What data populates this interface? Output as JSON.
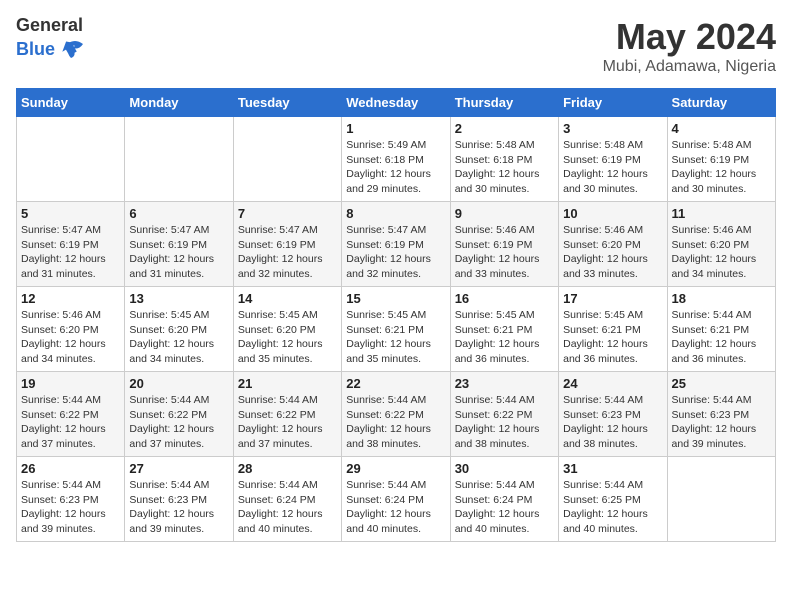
{
  "header": {
    "logo_general": "General",
    "logo_blue": "Blue",
    "title": "May 2024",
    "subtitle": "Mubi, Adamawa, Nigeria"
  },
  "columns": [
    "Sunday",
    "Monday",
    "Tuesday",
    "Wednesday",
    "Thursday",
    "Friday",
    "Saturday"
  ],
  "weeks": [
    [
      {
        "day": "",
        "info": ""
      },
      {
        "day": "",
        "info": ""
      },
      {
        "day": "",
        "info": ""
      },
      {
        "day": "1",
        "info": "Sunrise: 5:49 AM\nSunset: 6:18 PM\nDaylight: 12 hours\nand 29 minutes."
      },
      {
        "day": "2",
        "info": "Sunrise: 5:48 AM\nSunset: 6:18 PM\nDaylight: 12 hours\nand 30 minutes."
      },
      {
        "day": "3",
        "info": "Sunrise: 5:48 AM\nSunset: 6:19 PM\nDaylight: 12 hours\nand 30 minutes."
      },
      {
        "day": "4",
        "info": "Sunrise: 5:48 AM\nSunset: 6:19 PM\nDaylight: 12 hours\nand 30 minutes."
      }
    ],
    [
      {
        "day": "5",
        "info": "Sunrise: 5:47 AM\nSunset: 6:19 PM\nDaylight: 12 hours\nand 31 minutes."
      },
      {
        "day": "6",
        "info": "Sunrise: 5:47 AM\nSunset: 6:19 PM\nDaylight: 12 hours\nand 31 minutes."
      },
      {
        "day": "7",
        "info": "Sunrise: 5:47 AM\nSunset: 6:19 PM\nDaylight: 12 hours\nand 32 minutes."
      },
      {
        "day": "8",
        "info": "Sunrise: 5:47 AM\nSunset: 6:19 PM\nDaylight: 12 hours\nand 32 minutes."
      },
      {
        "day": "9",
        "info": "Sunrise: 5:46 AM\nSunset: 6:19 PM\nDaylight: 12 hours\nand 33 minutes."
      },
      {
        "day": "10",
        "info": "Sunrise: 5:46 AM\nSunset: 6:20 PM\nDaylight: 12 hours\nand 33 minutes."
      },
      {
        "day": "11",
        "info": "Sunrise: 5:46 AM\nSunset: 6:20 PM\nDaylight: 12 hours\nand 34 minutes."
      }
    ],
    [
      {
        "day": "12",
        "info": "Sunrise: 5:46 AM\nSunset: 6:20 PM\nDaylight: 12 hours\nand 34 minutes."
      },
      {
        "day": "13",
        "info": "Sunrise: 5:45 AM\nSunset: 6:20 PM\nDaylight: 12 hours\nand 34 minutes."
      },
      {
        "day": "14",
        "info": "Sunrise: 5:45 AM\nSunset: 6:20 PM\nDaylight: 12 hours\nand 35 minutes."
      },
      {
        "day": "15",
        "info": "Sunrise: 5:45 AM\nSunset: 6:21 PM\nDaylight: 12 hours\nand 35 minutes."
      },
      {
        "day": "16",
        "info": "Sunrise: 5:45 AM\nSunset: 6:21 PM\nDaylight: 12 hours\nand 36 minutes."
      },
      {
        "day": "17",
        "info": "Sunrise: 5:45 AM\nSunset: 6:21 PM\nDaylight: 12 hours\nand 36 minutes."
      },
      {
        "day": "18",
        "info": "Sunrise: 5:44 AM\nSunset: 6:21 PM\nDaylight: 12 hours\nand 36 minutes."
      }
    ],
    [
      {
        "day": "19",
        "info": "Sunrise: 5:44 AM\nSunset: 6:22 PM\nDaylight: 12 hours\nand 37 minutes."
      },
      {
        "day": "20",
        "info": "Sunrise: 5:44 AM\nSunset: 6:22 PM\nDaylight: 12 hours\nand 37 minutes."
      },
      {
        "day": "21",
        "info": "Sunrise: 5:44 AM\nSunset: 6:22 PM\nDaylight: 12 hours\nand 37 minutes."
      },
      {
        "day": "22",
        "info": "Sunrise: 5:44 AM\nSunset: 6:22 PM\nDaylight: 12 hours\nand 38 minutes."
      },
      {
        "day": "23",
        "info": "Sunrise: 5:44 AM\nSunset: 6:22 PM\nDaylight: 12 hours\nand 38 minutes."
      },
      {
        "day": "24",
        "info": "Sunrise: 5:44 AM\nSunset: 6:23 PM\nDaylight: 12 hours\nand 38 minutes."
      },
      {
        "day": "25",
        "info": "Sunrise: 5:44 AM\nSunset: 6:23 PM\nDaylight: 12 hours\nand 39 minutes."
      }
    ],
    [
      {
        "day": "26",
        "info": "Sunrise: 5:44 AM\nSunset: 6:23 PM\nDaylight: 12 hours\nand 39 minutes."
      },
      {
        "day": "27",
        "info": "Sunrise: 5:44 AM\nSunset: 6:23 PM\nDaylight: 12 hours\nand 39 minutes."
      },
      {
        "day": "28",
        "info": "Sunrise: 5:44 AM\nSunset: 6:24 PM\nDaylight: 12 hours\nand 40 minutes."
      },
      {
        "day": "29",
        "info": "Sunrise: 5:44 AM\nSunset: 6:24 PM\nDaylight: 12 hours\nand 40 minutes."
      },
      {
        "day": "30",
        "info": "Sunrise: 5:44 AM\nSunset: 6:24 PM\nDaylight: 12 hours\nand 40 minutes."
      },
      {
        "day": "31",
        "info": "Sunrise: 5:44 AM\nSunset: 6:25 PM\nDaylight: 12 hours\nand 40 minutes."
      },
      {
        "day": "",
        "info": ""
      }
    ]
  ]
}
